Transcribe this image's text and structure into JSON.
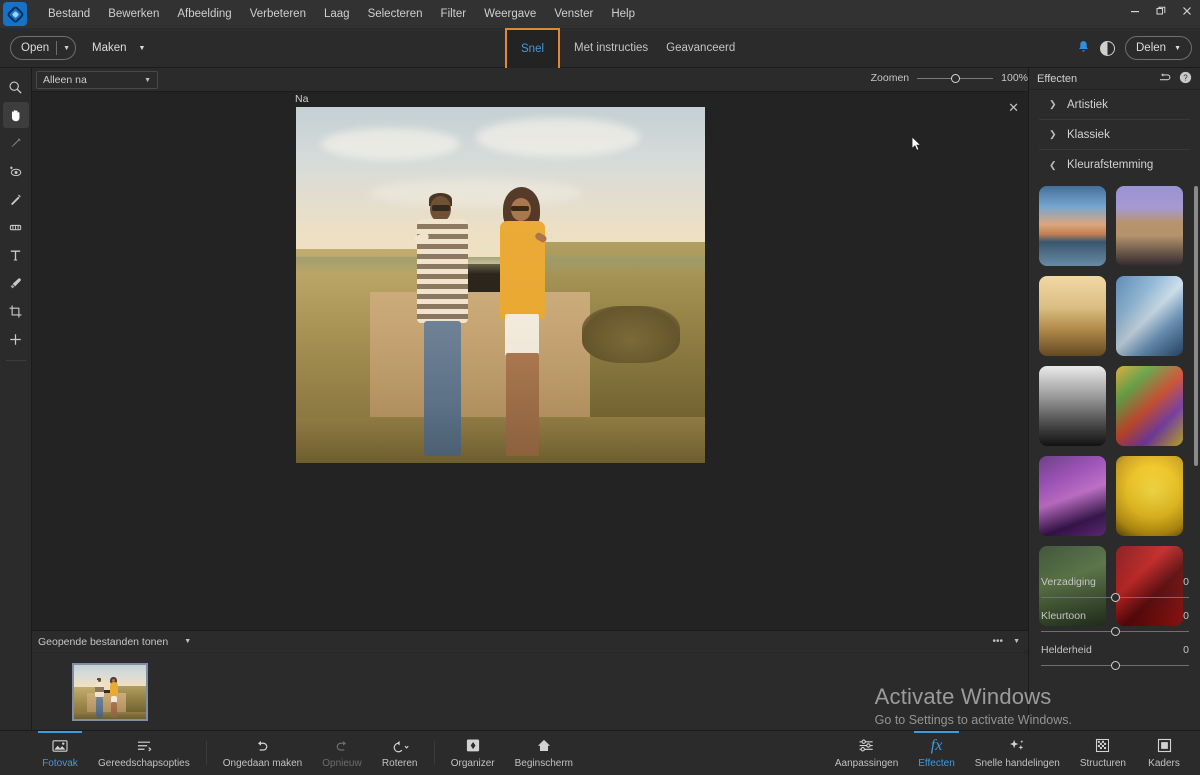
{
  "app": {
    "logo_icon": "photoshop-elements-logo",
    "window_controls": {
      "minimize": "minimize-icon",
      "restore": "restore-icon",
      "close": "close-icon"
    }
  },
  "menubar": {
    "items": [
      {
        "label": "Bestand"
      },
      {
        "label": "Bewerken"
      },
      {
        "label": "Afbeelding"
      },
      {
        "label": "Verbeteren"
      },
      {
        "label": "Laag"
      },
      {
        "label": "Selecteren"
      },
      {
        "label": "Filter"
      },
      {
        "label": "Weergave"
      },
      {
        "label": "Venster"
      },
      {
        "label": "Help"
      }
    ]
  },
  "tabbar": {
    "open_label": "Open",
    "maken_label": "Maken",
    "modes": [
      {
        "label": "Snel",
        "active": true
      },
      {
        "label": "Met instructies",
        "active": false
      },
      {
        "label": "Geavanceerd",
        "active": false
      }
    ],
    "notification_icon": "bell-icon",
    "contrast_icon": "contrast-toggle-icon",
    "share_label": "Delen"
  },
  "subbar": {
    "view_mode": "Alleen na",
    "zoom_label": "Zoomen",
    "zoom_value": "100%"
  },
  "toolbar": {
    "tools": [
      {
        "name": "zoom-tool",
        "icon": "magnifier-icon",
        "active": false
      },
      {
        "name": "hand-tool",
        "icon": "hand-icon",
        "active": true
      },
      {
        "name": "quick-selection-tool",
        "icon": "lasso-icon",
        "active": false
      },
      {
        "name": "red-eye-tool",
        "icon": "red-eye-icon",
        "active": false
      },
      {
        "name": "spot-healing-tool",
        "icon": "healing-brush-icon",
        "active": false
      },
      {
        "name": "whiten-teeth-tool",
        "icon": "teeth-icon",
        "active": false
      },
      {
        "name": "text-tool",
        "icon": "text-t-icon",
        "active": false
      },
      {
        "name": "brush-tool",
        "icon": "brush-icon",
        "active": false
      },
      {
        "name": "crop-tool",
        "icon": "crop-icon",
        "active": false
      },
      {
        "name": "move-tool",
        "icon": "move-plus-icon",
        "active": false
      }
    ]
  },
  "canvas": {
    "close_icon": "close-icon",
    "image_label": "Na",
    "image_alt": "couple walking on a country road"
  },
  "photo_bin": {
    "filter_label": "Geopende bestanden tonen",
    "more_icon": "more-options-icon",
    "collapse_icon": "chevron-down-icon",
    "thumbnail_alt": "couple walking on a country road"
  },
  "effects_panel": {
    "title": "Effecten",
    "reset_icon": "reset-icon",
    "help_icon": "help-icon",
    "sections": [
      {
        "label": "Artistiek",
        "expanded": false
      },
      {
        "label": "Klassiek",
        "expanded": false
      },
      {
        "label": "Kleurafstemming",
        "expanded": true
      }
    ],
    "thumbnails": [
      {
        "name": "effect-sunset-lake"
      },
      {
        "name": "effect-desert-road"
      },
      {
        "name": "effect-golden-horse"
      },
      {
        "name": "effect-blue-feathers"
      },
      {
        "name": "effect-bw-cathedral"
      },
      {
        "name": "effect-colorful-abstract"
      },
      {
        "name": "effect-purple-flowers"
      },
      {
        "name": "effect-yellow-flower"
      },
      {
        "name": "effect-green-leaves"
      },
      {
        "name": "effect-red-rose"
      }
    ],
    "sliders": [
      {
        "label": "Verzadiging",
        "value": "0"
      },
      {
        "label": "Kleurtoon",
        "value": "0"
      },
      {
        "label": "Helderheid",
        "value": "0"
      }
    ]
  },
  "bottombar": {
    "left": [
      {
        "label": "Fotovak",
        "icon": "photo-bin-icon",
        "active": true,
        "dim": false
      },
      {
        "label": "Gereedschapsopties",
        "icon": "tool-options-icon",
        "active": false,
        "dim": false
      },
      {
        "label": "Ongedaan maken",
        "icon": "undo-icon",
        "active": false,
        "dim": false
      },
      {
        "label": "Opnieuw",
        "icon": "redo-icon",
        "active": false,
        "dim": true
      },
      {
        "label": "Roteren",
        "icon": "rotate-icon",
        "active": false,
        "dim": false
      },
      {
        "label": "Organizer",
        "icon": "organizer-icon",
        "active": false,
        "dim": false
      },
      {
        "label": "Beginscherm",
        "icon": "home-icon",
        "active": false,
        "dim": false
      }
    ],
    "right": [
      {
        "label": "Aanpassingen",
        "icon": "adjustments-icon",
        "active": false
      },
      {
        "label": "Effecten",
        "icon": "fx-icon",
        "active": true
      },
      {
        "label": "Snelle handelingen",
        "icon": "sparkles-icon",
        "active": false
      },
      {
        "label": "Structuren",
        "icon": "textures-icon",
        "active": false
      },
      {
        "label": "Kaders",
        "icon": "frames-icon",
        "active": false
      }
    ]
  },
  "watermark": {
    "title": "Activate Windows",
    "subtitle": "Go to Settings to activate Windows."
  },
  "colors": {
    "accent_blue": "#3f9ae0",
    "highlight_orange": "#e08a2e",
    "panel_bg": "#2b2b2b",
    "canvas_bg": "#232323"
  }
}
